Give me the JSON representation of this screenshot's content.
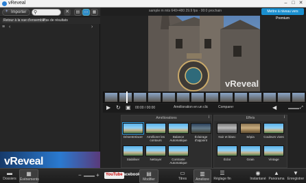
{
  "window": {
    "title": "vReveal",
    "minimize": "–",
    "maximize": "□",
    "close": "✕"
  },
  "left": {
    "import_label": "Importer",
    "clear": "✕",
    "back_label": "Retour à la vue d'ensemble",
    "results_label": "Pas de résultats",
    "sort_icon": "≡",
    "prev": "‹",
    "next": "›",
    "brand": "vReveal"
  },
  "bottom": {
    "folders": "Dossiers",
    "events": "Événements",
    "zoom_minus": "−",
    "zoom_plus": "+",
    "youtube": "YouTube",
    "facebook": "facebook",
    "modify": "Modifier",
    "titles": "Titres",
    "enhance": "Améliore",
    "settings": "Réglage fin",
    "instant": "Instantané",
    "panorama": "Panorama",
    "save": "Enregistrer"
  },
  "header": {
    "info": "sample m mts    640×480    29.9 fps · 00:0 prochain",
    "share": "Mettre à niveau vers Premium"
  },
  "controls": {
    "time": "00:00 / 00:00",
    "enhance_click": "Amélioration en un clic",
    "compare": "Comparer"
  },
  "ameliorations": {
    "title": "Améliorations",
    "info": "i",
    "tiles": [
      {
        "label": "Désentrelacer"
      },
      {
        "label": "Améliorer les contours"
      },
      {
        "label": "Balance Automatique"
      },
      {
        "label": "Éclairage d'appoint"
      },
      {
        "label": "Stabiliser"
      },
      {
        "label": "Nettoyer"
      },
      {
        "label": "Contraste Automatique"
      }
    ]
  },
  "effets": {
    "title": "Effets",
    "info": "i",
    "tiles": [
      {
        "label": "Noir et blanc"
      },
      {
        "label": "Sépia"
      },
      {
        "label": "Couleurs vives"
      },
      {
        "label": "Éclat"
      },
      {
        "label": "Grain"
      },
      {
        "label": "Vintage"
      }
    ]
  }
}
